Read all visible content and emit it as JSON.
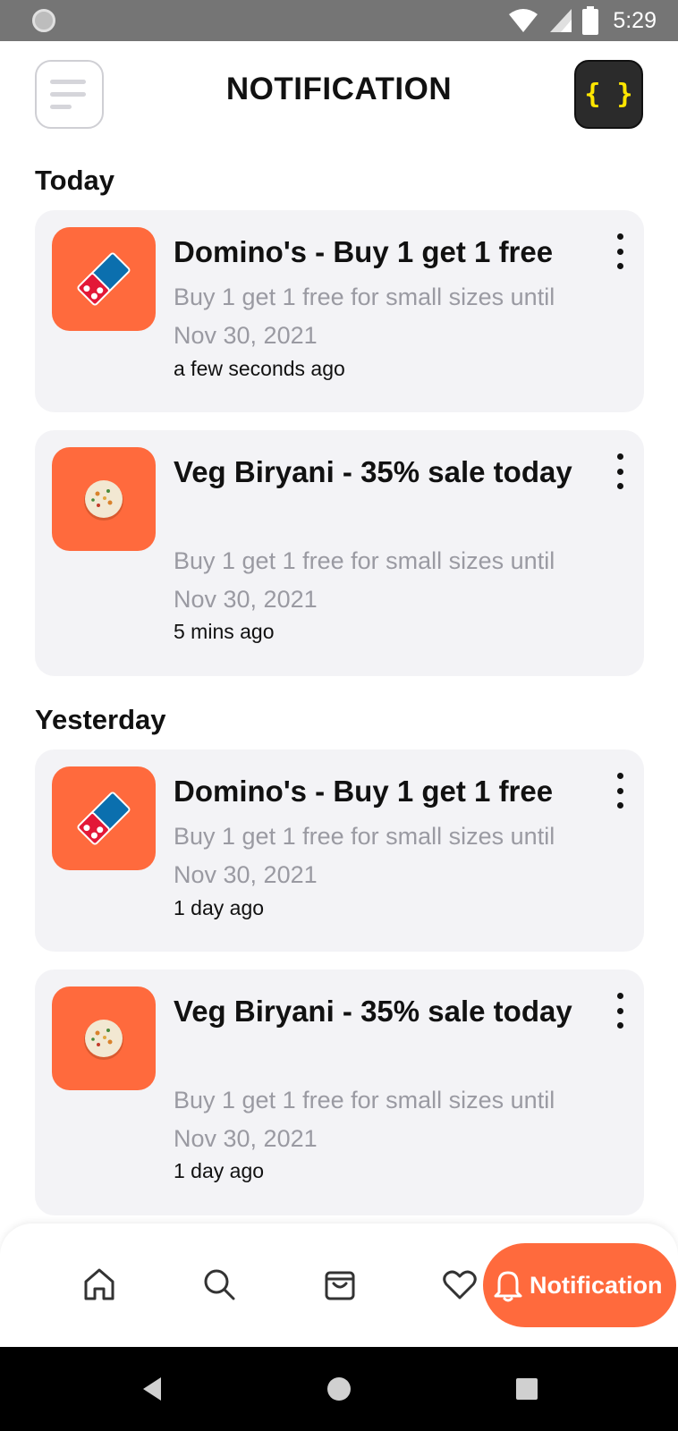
{
  "status_bar": {
    "time": "5:29"
  },
  "header": {
    "title": "NOTIFICATION",
    "code_button": "{ }"
  },
  "sections": [
    {
      "title": "Today",
      "items": [
        {
          "title": "Domino's - Buy 1 get 1 free",
          "description": "Buy 1 get 1 free for small sizes until Nov 30, 2021",
          "time": "a few seconds ago",
          "icon": "dominos-logo-icon",
          "logo_text": "Domino's Pizza"
        },
        {
          "title": "Veg Biryani - 35% sale today",
          "description": "Buy 1 get 1 free for small sizes until Nov 30, 2021",
          "time": "5 mins ago",
          "icon": "biryani-bowl-icon"
        }
      ]
    },
    {
      "title": "Yesterday",
      "items": [
        {
          "title": "Domino's - Buy 1 get 1 free",
          "description": "Buy 1 get 1 free for small sizes until Nov 30, 2021",
          "time": "1 day ago",
          "icon": "dominos-logo-icon",
          "logo_text": "Domino's Pizza"
        },
        {
          "title": "Veg Biryani - 35% sale today",
          "description": "Buy 1 get 1 free for small sizes until Nov 30, 2021",
          "time": "1 day ago",
          "icon": "biryani-bowl-icon"
        }
      ]
    }
  ],
  "bottom_nav": {
    "items": [
      "home-icon",
      "search-icon",
      "bag-icon",
      "heart-icon"
    ],
    "active_label": "Notification",
    "active_icon": "bell-icon"
  },
  "colors": {
    "accent": "#ff6a3d",
    "card_bg": "#f3f3f6",
    "muted_text": "#9a9aa2",
    "dominos_red": "#e31837",
    "dominos_blue": "#0b6fae"
  }
}
